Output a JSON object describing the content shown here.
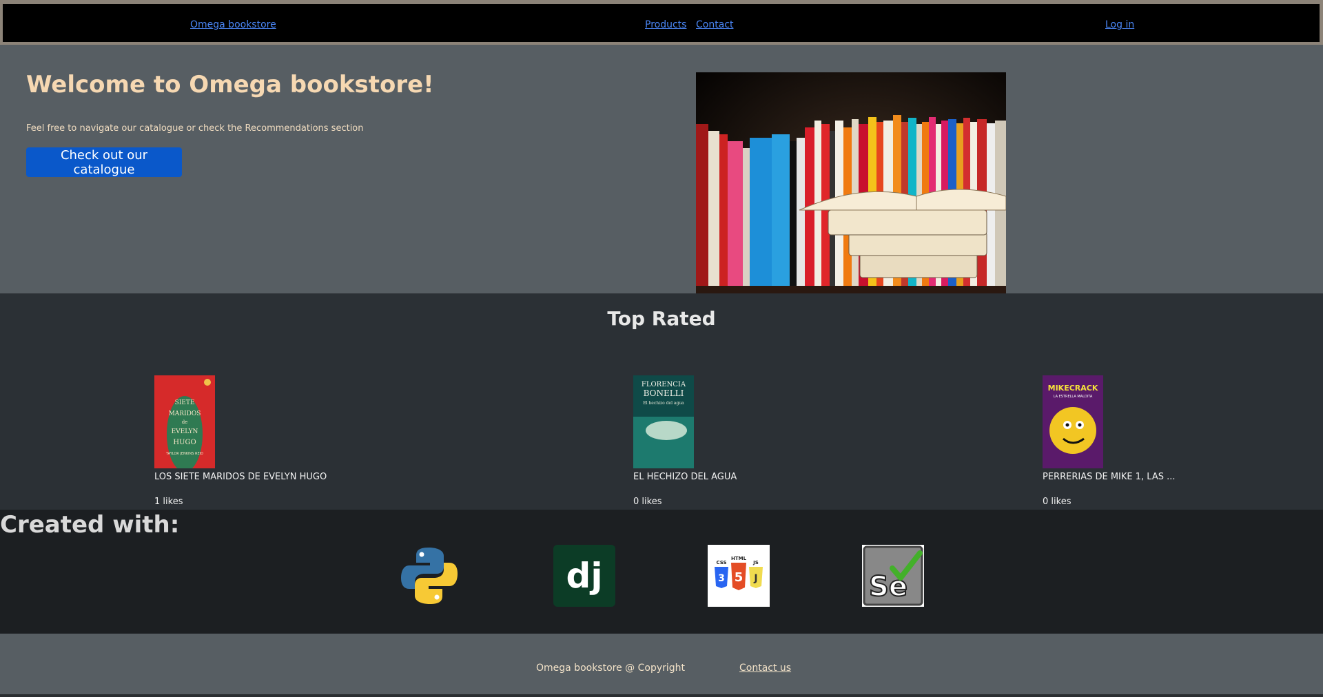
{
  "nav": {
    "brand": "Omega bookstore",
    "products": "Products",
    "contact": "Contact",
    "login": "Log in"
  },
  "hero": {
    "title": "Welcome to Omega bookstore!",
    "subtitle": "Feel free to navigate our catalogue or check the Recommendations section",
    "button": "Check out our catalogue"
  },
  "top_rated": {
    "heading": "Top Rated",
    "books": [
      {
        "title": "LOS SIETE MARIDOS DE EVELYN HUGO",
        "likes": "1 likes",
        "cover_text": [
          "SIETE",
          "MARIDOS",
          "de",
          "EVELYN",
          "HUGO",
          "TAYLOR JENKINS REID"
        ]
      },
      {
        "title": "EL HECHIZO DEL AGUA",
        "likes": "0 likes",
        "cover_text": [
          "FLORENCIA",
          "BONELLI",
          "El hechizo del agua"
        ]
      },
      {
        "title": "PERRERIAS DE MIKE 1, LAS ...",
        "likes": "0 likes",
        "cover_text": [
          "MIKECRACK",
          "LA ESTRELLA MALDITA"
        ]
      }
    ]
  },
  "created_with": {
    "heading": "Created with:",
    "logos": [
      "python-logo",
      "django-logo",
      "html-css-js-logo",
      "selenium-logo"
    ],
    "django_text": "dj",
    "html_labels": [
      "CSS",
      "HTML",
      "JS"
    ]
  },
  "footer": {
    "copyright": "Omega bookstore @ Copyright",
    "contact_link": "Contact us"
  },
  "colors": {
    "nav_bg": "#000000",
    "hero_bg": "#575e63",
    "top_rated_bg": "#2b3035",
    "created_bg": "#1c1f22",
    "button_bg": "#0a58ca",
    "hero_title": "#f6d8b2"
  }
}
